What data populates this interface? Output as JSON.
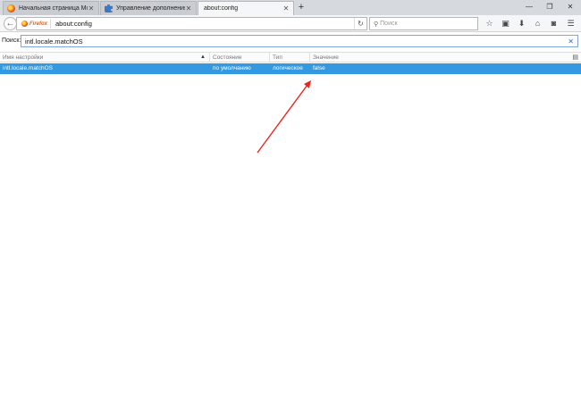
{
  "tabs": [
    {
      "title": "Начальная страница Mo...",
      "icon": "firefox-icon",
      "active": false
    },
    {
      "title": "Управление дополнения...",
      "icon": "puzzle-icon",
      "active": false
    },
    {
      "title": "about:config",
      "icon": "",
      "active": true
    }
  ],
  "window_controls": {
    "minimize": "—",
    "restore": "❐",
    "close": "✕"
  },
  "navbar": {
    "identity_label": "Firefox",
    "url": "about:config",
    "search_placeholder": "Поиск"
  },
  "search_row": {
    "label": "Поиск:",
    "value": "intl.locale.matchOS"
  },
  "table": {
    "columns": [
      "Имя настройки",
      "Состояние",
      "Тип",
      "Значение"
    ],
    "rows": [
      {
        "name": "intl.locale.matchOS",
        "status": "по умолчанию",
        "type": "логическое",
        "value": "false",
        "selected": true
      }
    ]
  },
  "colors": {
    "selection": "#3399e0",
    "annotation_arrow": "#e8261f"
  }
}
